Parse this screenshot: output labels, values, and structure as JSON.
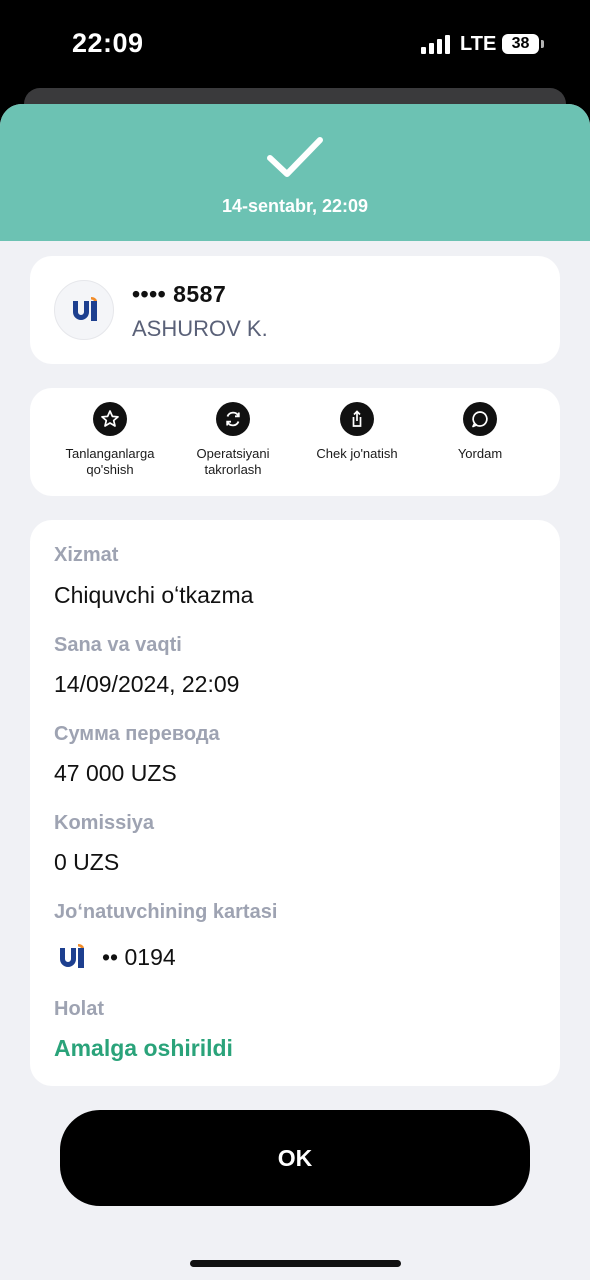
{
  "status_bar": {
    "time": "22:09",
    "network": "LTE",
    "battery": "38"
  },
  "header": {
    "datetime": "14-sentabr, 22:09",
    "icon": "checkmark-icon"
  },
  "recipient": {
    "card_masked": "•••• 8587",
    "name": "ASHUROV K.",
    "logo_icon": "uzcard-logo-icon"
  },
  "actions": [
    {
      "label": "Tanlanganlarga qo'shish",
      "icon": "star-icon"
    },
    {
      "label": "Operatsiyani takrorlash",
      "icon": "repeat-icon"
    },
    {
      "label": "Chek jo'natish",
      "icon": "share-icon"
    },
    {
      "label": "Yordam",
      "icon": "chat-icon"
    }
  ],
  "details": {
    "service_label": "Xizmat",
    "service_value": "Chiquvchi oʻtkazma",
    "datetime_label": "Sana va vaqti",
    "datetime_value": "14/09/2024, 22:09",
    "amount_label": "Сумма перевода",
    "amount_value": "47 000 UZS",
    "fee_label": "Komissiya",
    "fee_value": "0 UZS",
    "sender_card_label": "Joʻnatuvchining kartasi",
    "sender_card_value": "•• 0194",
    "status_label": "Holat",
    "status_value": "Amalga oshirildi"
  },
  "ok_button": "OK",
  "colors": {
    "header": "#6cc2b3",
    "status_success": "#2aa37a",
    "background": "#f0f1f5"
  }
}
